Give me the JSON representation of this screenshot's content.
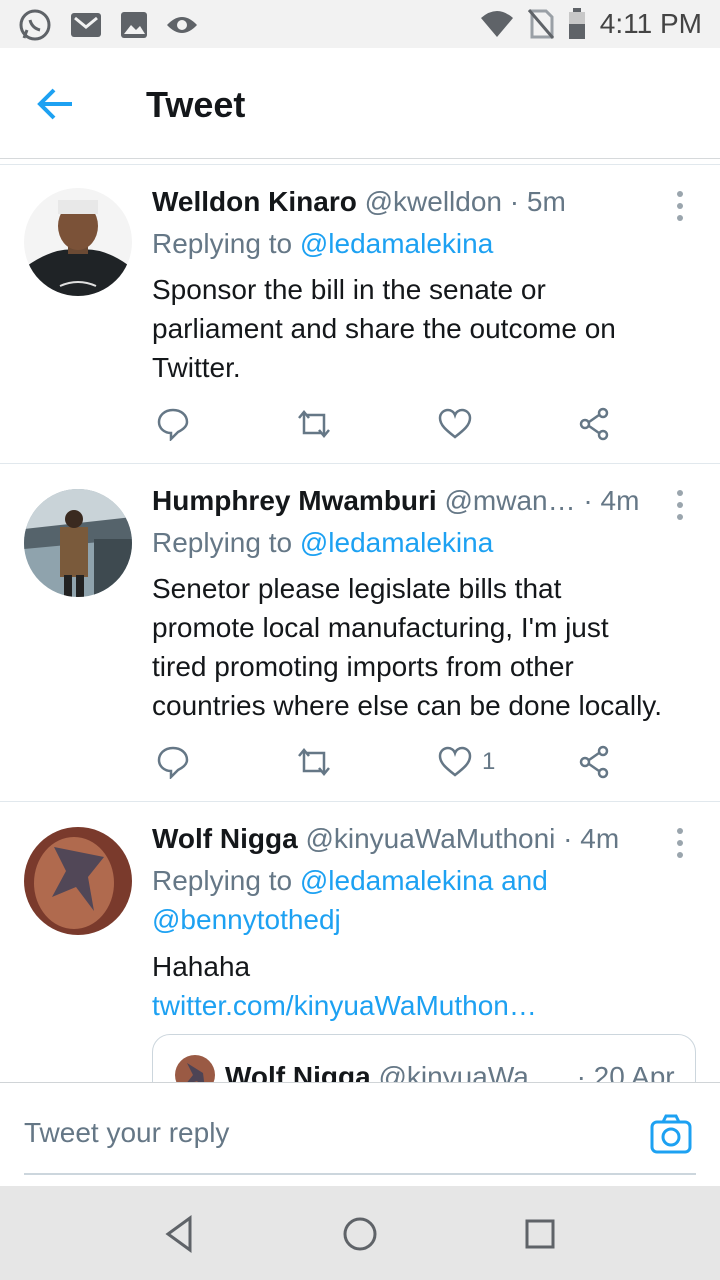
{
  "status_bar": {
    "time": "4:11 PM",
    "left_icons": [
      "whatsapp-icon",
      "gmail-icon",
      "image-icon",
      "eye-icon"
    ],
    "right_icons": [
      "wifi-icon",
      "no-sim-icon",
      "battery-icon"
    ]
  },
  "app_bar": {
    "title": "Tweet",
    "back_icon": "back-arrow-icon"
  },
  "tweets": [
    {
      "name": "Welldon Kinaro",
      "handle": "@kwelldon",
      "time": " · 5m",
      "replying_prefix": "Replying to ",
      "replying_to": "@ledamalekina",
      "text_lines": [
        "Sponsor the bill in the senate or",
        "parliament and share the outcome on",
        "Twitter."
      ],
      "likes": ""
    },
    {
      "name": "Humphrey Mwamburi",
      "handle": "@mwan…",
      "time": " · 4m",
      "replying_prefix": "Replying to ",
      "replying_to": "@ledamalekina",
      "text_lines": [
        "Senetor please legislate bills that",
        "promote local manufacturing, I'm just",
        "tired promoting imports from other",
        "countries where else can be done locally."
      ],
      "likes": "1"
    },
    {
      "name": "Wolf Nigga",
      "handle": "@kinyuaWaMuthoni",
      "time": " · 4m",
      "replying_prefix": "Replying to ",
      "replying_to": "@ledamalekina and",
      "replying_to_2": "@bennytothedj",
      "text": "Hahaha",
      "link": "twitter.com/kinyuaWaMuthon…",
      "quote": {
        "name": "Wolf Nigga",
        "handle": "@kinyuaWa…",
        "time": "· 20 Apr"
      }
    }
  ],
  "reply_bar": {
    "placeholder": "Tweet your reply"
  },
  "colors": {
    "accent": "#1da1f2",
    "secondary_text": "#657786",
    "primary_text": "#14171a",
    "divider": "#e1e8ed"
  }
}
